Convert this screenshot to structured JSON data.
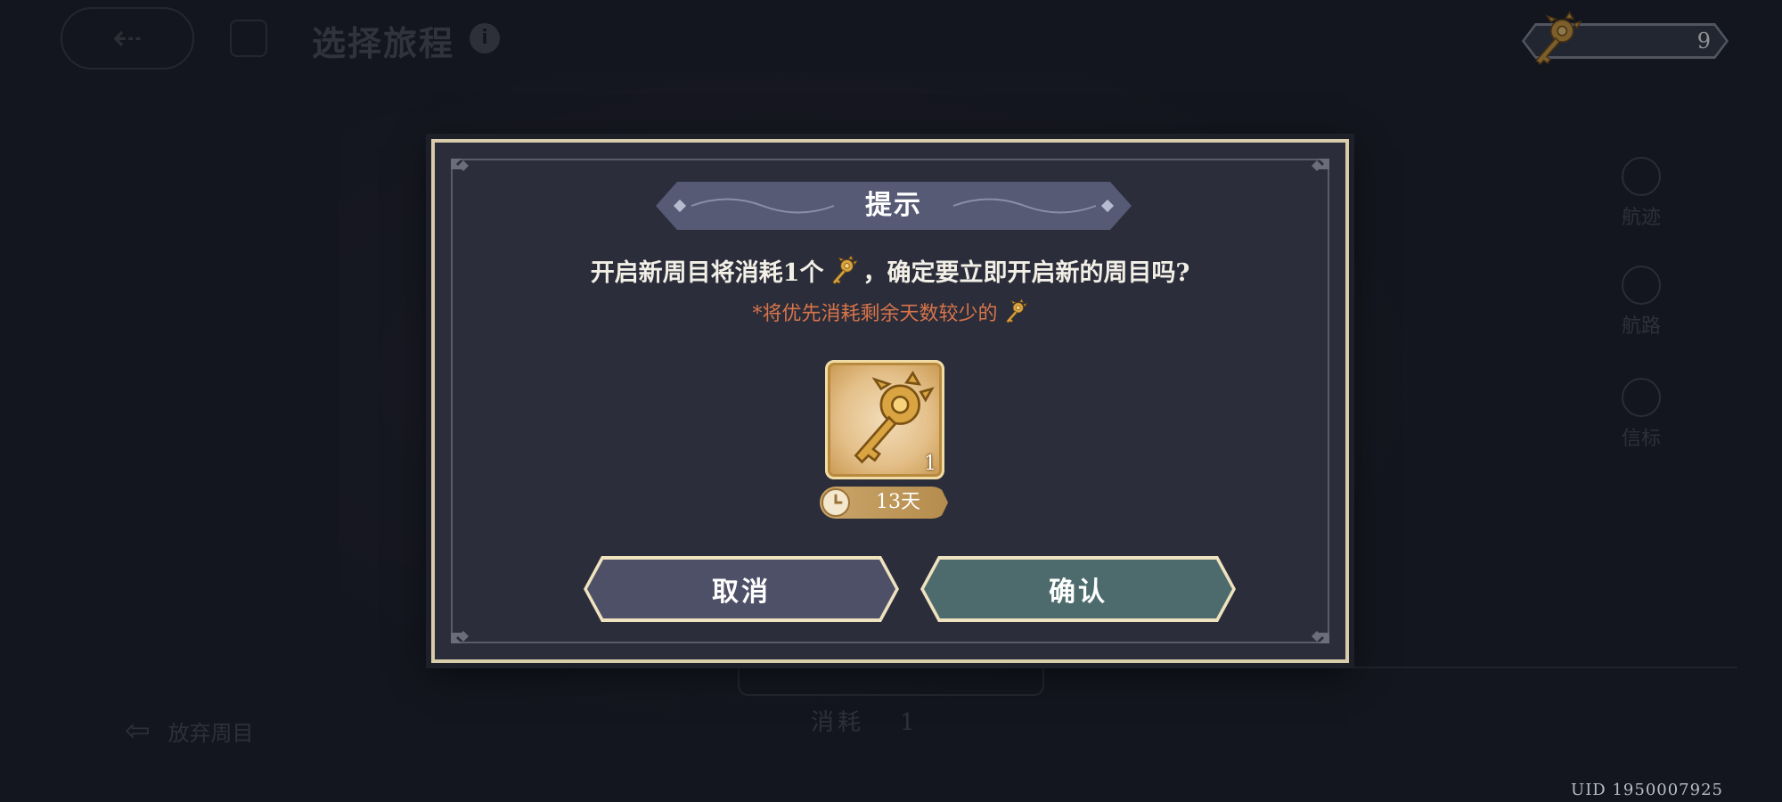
{
  "background": {
    "title": "选择旅程",
    "side_items": [
      "航迹",
      "航路",
      "信标"
    ],
    "abandon_label": "放弃周目",
    "consume_label": "消耗",
    "consume_amount": "1"
  },
  "key_counter": {
    "value": "9",
    "icon": "golden-key-icon"
  },
  "dialog": {
    "title": "提示",
    "message_before": "开启新周目将消耗1个",
    "message_after": "，确定要立即开启新的周目吗?",
    "note_before": "*将优先消耗剩余天数较少的",
    "item": {
      "icon": "golden-key-icon",
      "quantity": "1",
      "remaining": "13天"
    },
    "cancel_label": "取消",
    "confirm_label": "确认"
  },
  "uid": "UID 1950007925",
  "colors": {
    "modal_bg": "#2b2d3a",
    "modal_border": "#d9ccab",
    "note": "#d8754a",
    "cancel_button": "#4e5067",
    "confirm_button": "#4d6b6c",
    "banner": "#565a74"
  }
}
